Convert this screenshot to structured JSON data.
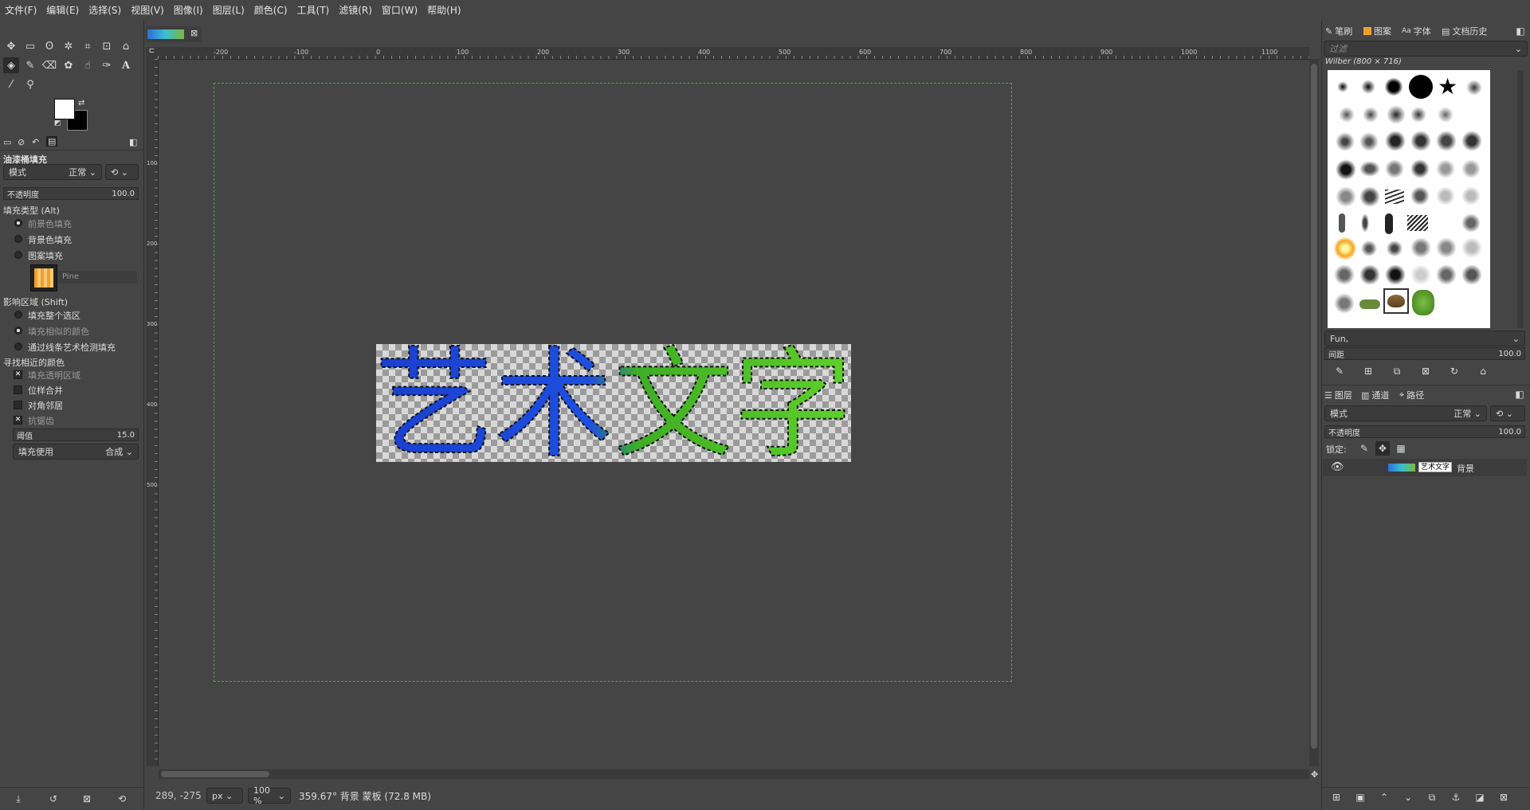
{
  "menubar": {
    "items": [
      "文件(F)",
      "编辑(E)",
      "选择(S)",
      "视图(V)",
      "图像(I)",
      "图层(L)",
      "颜色(C)",
      "工具(T)",
      "滤镜(R)",
      "窗口(W)",
      "帮助(H)"
    ]
  },
  "tool_options": {
    "title": "油漆桶填充",
    "mode_label": "模式",
    "mode_value": "正常",
    "opacity_label": "不透明度",
    "opacity_value": "100.0",
    "fill_type_label": "填充类型 (Alt)",
    "fill_types": [
      "前景色填充",
      "背景色填充",
      "图案填充"
    ],
    "pattern_name": "Pine",
    "affected_area_label": "影响区域 (Shift)",
    "affected_areas": [
      "填充整个选区",
      "填充相似的颜色",
      "通过线条艺术检测填充"
    ],
    "find_similar_label": "寻找相近的颜色",
    "options": [
      "填充透明区域",
      "位样合并",
      "对角邻居",
      "抗锯齿"
    ],
    "threshold_label": "阈值",
    "threshold_value": "15.0",
    "fill_by_label": "填充使用",
    "fill_by_value": "合成"
  },
  "ruler_top": {
    "labels": [
      "-200",
      "-100",
      "0",
      "100",
      "200",
      "300",
      "400",
      "500",
      "600",
      "700",
      "800",
      "900",
      "1000",
      "1100"
    ]
  },
  "ruler_left": {
    "labels": [
      "100",
      "200",
      "300",
      "400",
      "500"
    ]
  },
  "image": {
    "text": "艺术文字"
  },
  "status": {
    "coords": "289, -275",
    "unit": "px",
    "zoom": "100 %",
    "info": "359.67° 背景 蒙板 (72.8 MB)"
  },
  "dock": {
    "tabs": [
      "笔刷",
      "图案",
      "字体",
      "文档历史"
    ],
    "filter_placeholder": "过滤",
    "brush_title": "Wilber (800 × 716)",
    "brush_preset": "Fun,",
    "spacing_label": "间距",
    "spacing_value": "100.0",
    "layer_tabs": [
      "图层",
      "通道",
      "路径"
    ],
    "layer_mode_label": "模式",
    "layer_mode_value": "正常",
    "layer_opacity_label": "不透明度",
    "layer_opacity_value": "100.0",
    "lock_label": "锁定:",
    "layer_name": "背景",
    "mask_label": "艺术文字"
  },
  "colors": {
    "canvas_border": "#3fae3f",
    "selection_dash": "#000000"
  }
}
